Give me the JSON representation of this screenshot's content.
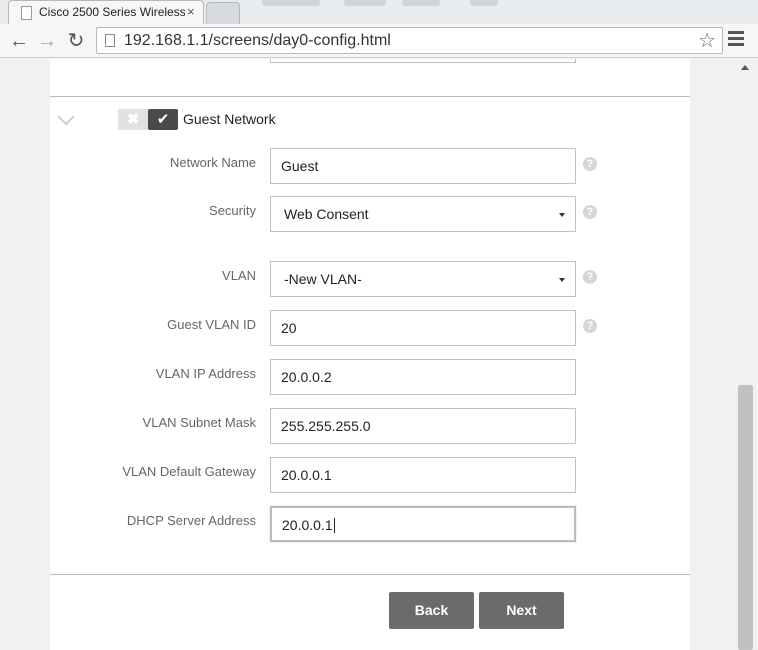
{
  "browser": {
    "tab_title": "Cisco 2500 Series Wireless",
    "tab_close": "×",
    "url": "192.168.1.1/screens/day0-config.html",
    "back": "←",
    "forward": "→",
    "reload": "↻",
    "star": "☆"
  },
  "section": {
    "title": "Guest Network",
    "toggle_off_glyph": "✖",
    "toggle_on_glyph": "✔",
    "enabled": true
  },
  "fields": [
    {
      "label": "Network Name",
      "value": "Guest",
      "type": "text",
      "help": true
    },
    {
      "label": "Security",
      "value": "Web Consent",
      "type": "select",
      "help": true
    },
    {
      "label": "VLAN",
      "value": "-New VLAN-",
      "type": "select",
      "help": true
    },
    {
      "label": "Guest VLAN ID",
      "value": "20",
      "type": "text",
      "help": true
    },
    {
      "label": "VLAN IP Address",
      "value": "20.0.0.2",
      "type": "text",
      "help": false
    },
    {
      "label": "VLAN Subnet Mask",
      "value": "255.255.255.0",
      "type": "text",
      "help": false
    },
    {
      "label": "VLAN Default Gateway",
      "value": "20.0.0.1",
      "type": "text",
      "help": false
    },
    {
      "label": "DHCP Server Address",
      "value": "20.0.0.1",
      "type": "text",
      "help": false,
      "focused": true
    }
  ],
  "help_glyph": "?",
  "buttons": {
    "back": "Back",
    "next": "Next"
  },
  "icons": {
    "help": "help-icon",
    "chevron": "chevron-down-icon",
    "toggle_off": "close-icon",
    "toggle_on": "check-icon",
    "page": "page-icon",
    "menu": "menu-icon"
  },
  "colors": {
    "button_bg": "#6b6b6b",
    "divider": "#a9c0c8",
    "toggle_on": "#4a4a4a"
  }
}
